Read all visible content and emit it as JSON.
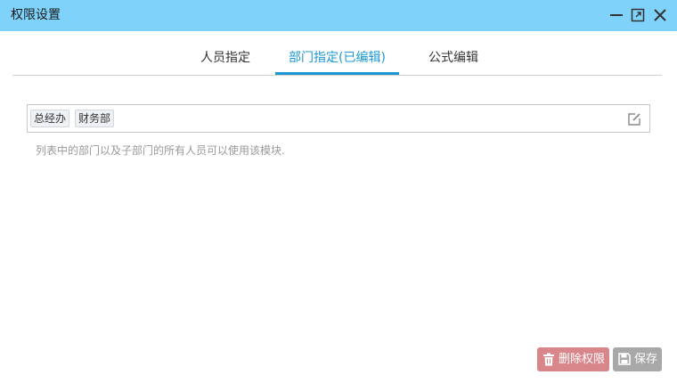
{
  "window": {
    "title": "权限设置",
    "controls": [
      "minimize-icon",
      "maximize-icon",
      "close-icon"
    ]
  },
  "tabs": [
    {
      "label": "人员指定",
      "active": false
    },
    {
      "label": "部门指定(已编辑)",
      "active": true
    },
    {
      "label": "公式编辑",
      "active": false
    }
  ],
  "department_selector": {
    "tags": [
      "总经办",
      "财务部"
    ],
    "edit_icon": "edit-icon"
  },
  "hint": "列表中的部门以及子部门的所有人员可以使用该模块.",
  "actions": {
    "delete_label": "删除权限",
    "save_label": "保存"
  },
  "colors": {
    "titlebar": "#7fd3fa",
    "active_tab": "#1c97d4",
    "delete_button": "#d9868a",
    "save_button": "#a8a8a8"
  }
}
